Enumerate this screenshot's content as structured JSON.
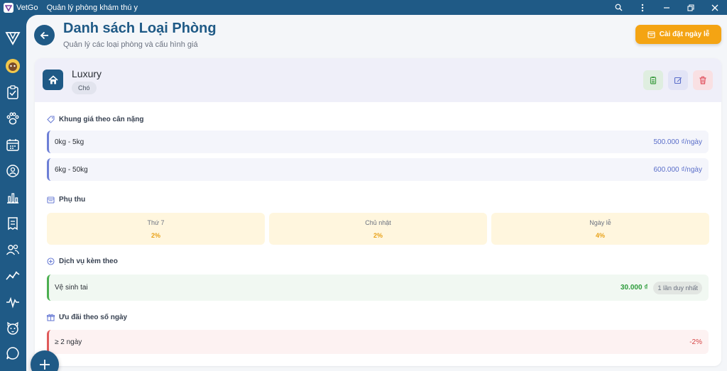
{
  "titlebar": {
    "app_name": "VetGo",
    "subtitle": "Quản lý phòng khám thú y"
  },
  "header": {
    "title": "Danh sách Loại Phòng",
    "subtitle": "Quản lý các loại phòng và cấu hình giá",
    "holiday_button": "Cài đặt ngày lễ"
  },
  "room": {
    "name": "Luxury",
    "tag": "Chó"
  },
  "sections": {
    "weight_pricing": "Khung giá theo cân nặng",
    "surcharge": "Phụ thu",
    "services": "Dịch vụ kèm theo",
    "discounts": "Ưu đãi theo số ngày"
  },
  "weight_prices": [
    {
      "range": "0kg - 5kg",
      "price": "500.000 ₫/ngày"
    },
    {
      "range": "6kg - 50kg",
      "price": "600.000 ₫/ngày"
    }
  ],
  "surcharges": [
    {
      "label": "Thứ 7",
      "value": "2%"
    },
    {
      "label": "Chủ nhật",
      "value": "2%"
    },
    {
      "label": "Ngày lễ",
      "value": "4%"
    }
  ],
  "services": [
    {
      "name": "Vệ sinh tai",
      "price": "30.000 ₫",
      "badge": "1 lần duy nhất"
    }
  ],
  "discounts": [
    {
      "label": "≥ 2 ngày",
      "value": "-2%"
    }
  ],
  "icons": {
    "back": "arrow-left-icon",
    "holiday": "calendar-icon",
    "room": "home-icon",
    "copy": "clipboard-icon",
    "edit": "edit-icon",
    "delete": "trash-icon",
    "fab": "plus-icon"
  },
  "colors": {
    "primary": "#1f5a86",
    "accent": "#f4a413",
    "price": "#5a6ec9",
    "surcharge": "#e8a21a",
    "service": "#2e9c3c",
    "discount": "#d64545"
  }
}
